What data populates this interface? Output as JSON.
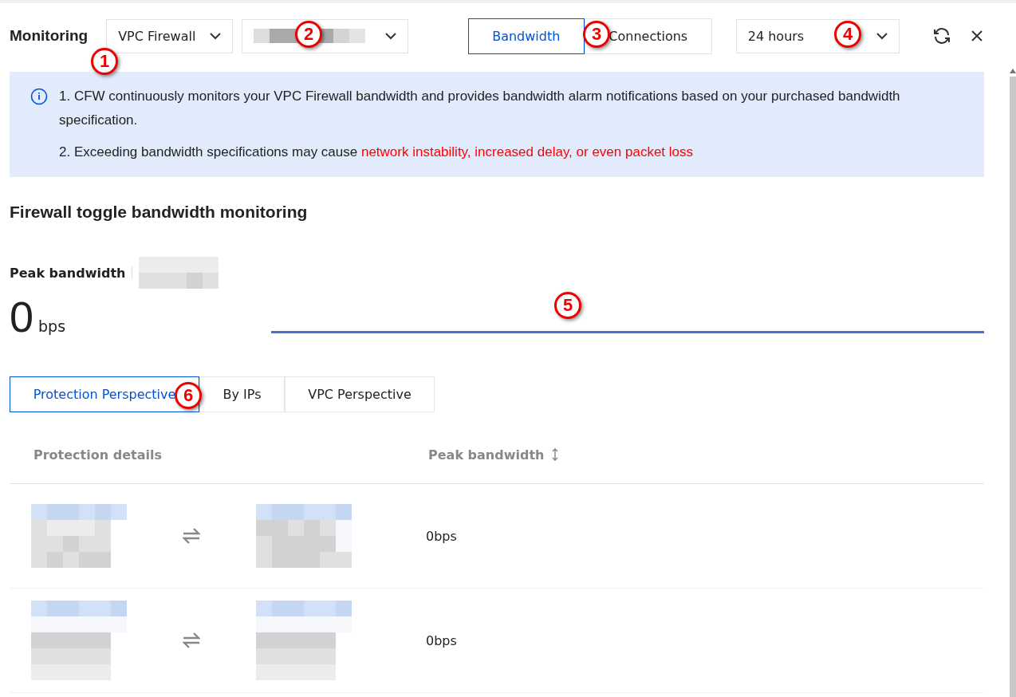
{
  "header": {
    "title": "Monitoring",
    "firewall_select": {
      "value": "VPC Firewall"
    },
    "instance_select": {
      "kind": "redacted"
    },
    "metric_tabs": [
      {
        "label": "Bandwidth",
        "selected": true
      },
      {
        "label": "Connections",
        "selected": false
      }
    ],
    "range_select": {
      "value": "24 hours"
    }
  },
  "notice": {
    "lines": [
      {
        "text": "1. CFW continuously monitors your VPC Firewall bandwidth and provides bandwidth alarm notifications based on your purchased bandwidth specification."
      },
      {
        "text": "2. Exceeding bandwidth specifications may cause ",
        "warning": "network instability, increased delay, or even packet loss"
      }
    ]
  },
  "section": {
    "title": "Firewall toggle bandwidth monitoring",
    "peak": {
      "label": "Peak bandwidth",
      "value": "0",
      "unit": "bps"
    }
  },
  "perspective_tabs": [
    {
      "label": "Protection Perspective",
      "selected": true
    },
    {
      "label": "By IPs",
      "selected": false
    },
    {
      "label": "VPC Perspective",
      "selected": false
    }
  ],
  "table": {
    "columns": [
      {
        "label": "Protection details",
        "sortable": false
      },
      {
        "label": "Peak bandwidth",
        "sortable": true
      }
    ],
    "rows": [
      {
        "peak": "0bps"
      },
      {
        "peak": "0bps"
      }
    ]
  },
  "callouts": [
    {
      "label": "1"
    },
    {
      "label": "2"
    },
    {
      "label": "3"
    },
    {
      "label": "4"
    },
    {
      "label": "5"
    },
    {
      "label": "6"
    }
  ]
}
